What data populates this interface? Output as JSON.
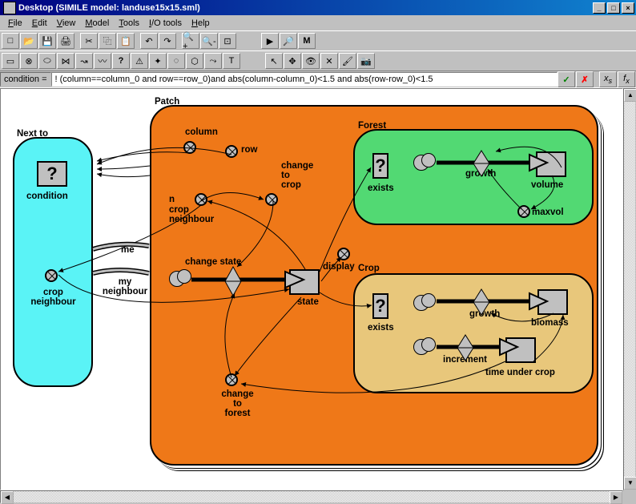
{
  "window": {
    "title": "Desktop (SIMILE model: landuse15x15.sml)"
  },
  "menu": [
    "File",
    "Edit",
    "View",
    "Model",
    "Tools",
    "I/O tools",
    "Help"
  ],
  "formula": {
    "label": "condition =",
    "value": "! (column==column_0 and row==row_0)and abs(column-column_0)<1.5 and abs(row-row_0)<1.5"
  },
  "submodels": {
    "patch": "Patch",
    "nextto": "Next to",
    "forest": "Forest",
    "crop": "Crop"
  },
  "nodes": {
    "condition": "condition",
    "crop_neighbour": "crop neighbour",
    "me": "me",
    "my_neighbour": "my neighbour",
    "column": "column",
    "row": "row",
    "n_crop_neighbour": "n crop neighbour",
    "change_to_crop": "change to crop",
    "change_state": "change state",
    "state": "state",
    "change_to_forest": "change to forest",
    "display": "display",
    "forest_exists": "exists",
    "forest_growth": "growth",
    "forest_volume": "volume",
    "forest_maxvol": "maxvol",
    "crop_exists": "exists",
    "crop_growth": "growth",
    "crop_biomass": "biomass",
    "crop_increment": "increment",
    "crop_time": "time under crop"
  }
}
